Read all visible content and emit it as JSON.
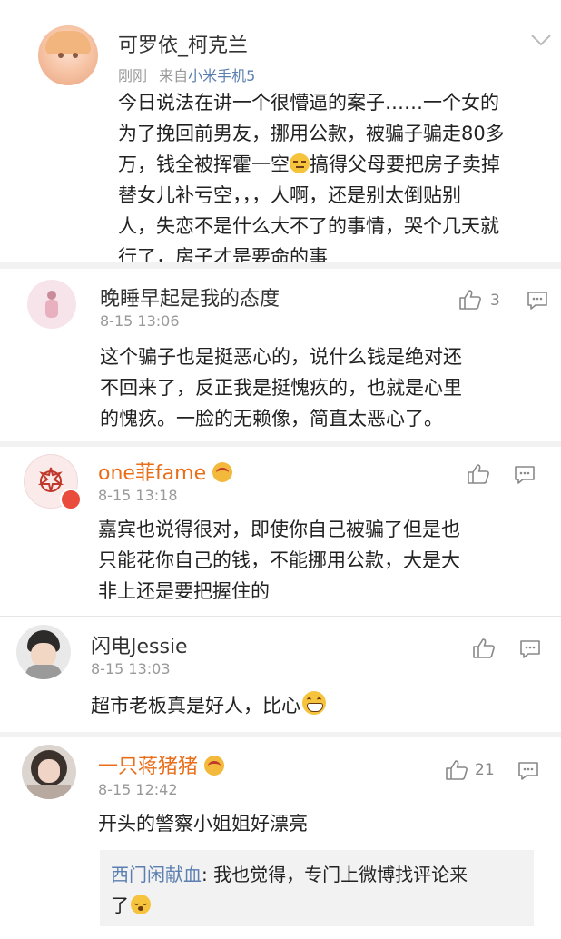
{
  "post": {
    "author": "可罗依_柯克兰",
    "time": "刚刚",
    "source_prefix": "来自",
    "source": "小米手机5",
    "lines": [
      "今日说法在讲一个很懵逼的案子……一个女的",
      "为了挽回前男友，挪用公款，被骗子骗走80多",
      "万，钱全被挥霍一空",
      "搞得父母要把房子卖掉",
      "替女儿补亏空，，，人啊，还是别太倒贴别",
      "人，失恋不是什么大不了的事情，哭个几天就",
      "行了，房子才是要命的事"
    ]
  },
  "comments": [
    {
      "author": "晚睡早起是我的态度",
      "time": "8-15 13:06",
      "likes": "3",
      "lines": [
        "这个骗子也是挺恶心的，说什么钱是绝对还",
        "不回来了，反正我是挺愧疚的，也就是心里",
        "的愧疚。一脸的无赖像，简直太恶心了。"
      ]
    },
    {
      "author": "one菲fame",
      "time": "8-15 13:18",
      "likes": "",
      "lines": [
        "嘉宾也说得很对，即使你自己被骗了但是也",
        "只能花你自己的钱，不能挪用公款，大是大",
        "非上还是要把握住的"
      ]
    },
    {
      "author": "闪电Jessie",
      "time": "8-15 13:03",
      "likes": "",
      "lines": [
        "超市老板真是好人，比心"
      ]
    },
    {
      "author": "一只蒋猪猪",
      "time": "8-15 12:42",
      "likes": "21",
      "lines": [
        "开头的警察小姐姐好漂亮"
      ],
      "reply": {
        "user": "西门闲献血",
        "text1": ": 我也觉得，专门上微博找评论来",
        "text2": "了"
      }
    }
  ],
  "icons": {
    "collapse": "chevron-down-icon",
    "like": "thumbs-up-icon",
    "reply": "comment-icon",
    "emoji_smirk": "smirk-emoji-icon",
    "emoji_grin": "grin-emoji-icon",
    "emoji_vip": "vip-crown-icon"
  },
  "colors": {
    "vip_name": "#ea6e1a",
    "link": "#5b7fb0",
    "meta": "#999999"
  }
}
